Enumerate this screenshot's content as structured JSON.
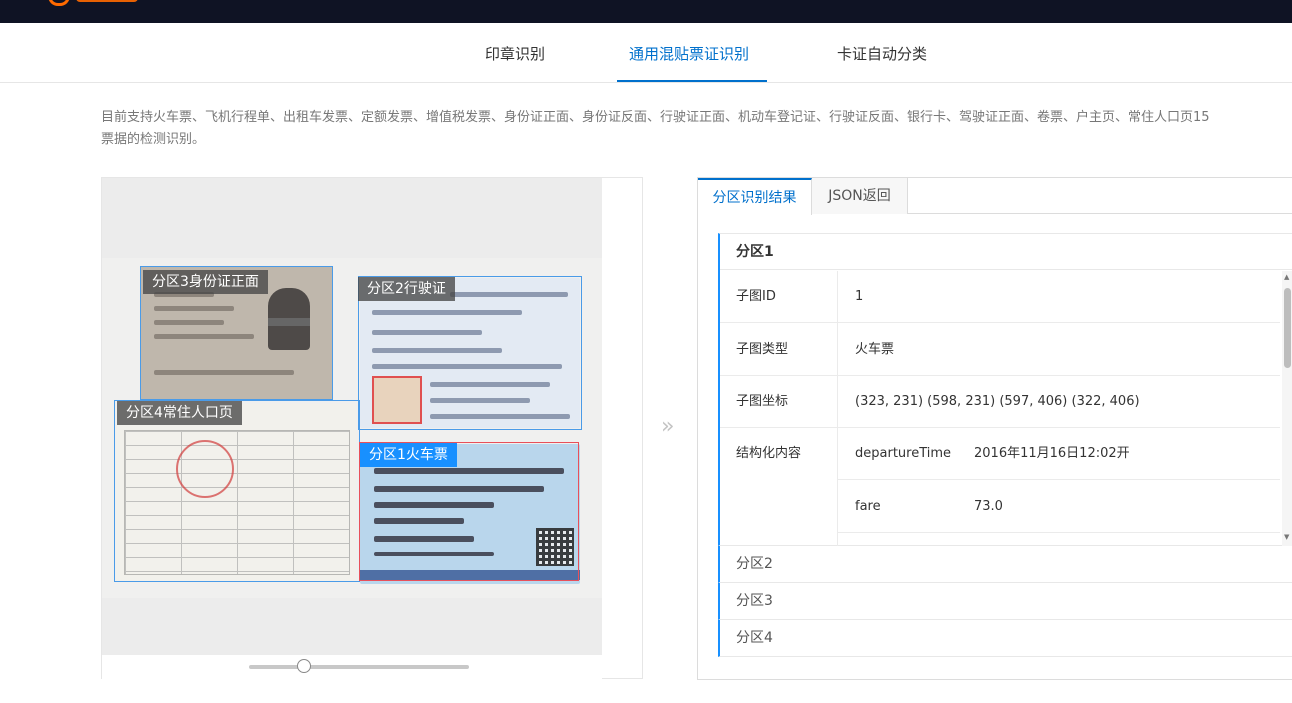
{
  "nav": {
    "tabs": [
      "印章识别",
      "通用混贴票证识别",
      "卡证自动分类"
    ],
    "active_tab": 1
  },
  "description": {
    "line1": "目前支持火车票、飞机行程单、出租车发票、定额发票、增值税发票、身份证正面、身份证反面、行驶证正面、机动车登记证、行驶证反面、银行卡、驾驶证正面、卷票、户主页、常住人口页15",
    "line2": "票据的检测识别。"
  },
  "viewer": {
    "zones": [
      {
        "label": "分区3身份证正面"
      },
      {
        "label": "分区2行驶证"
      },
      {
        "label": "分区4常住人口页"
      },
      {
        "label": "分区1火车票",
        "selected": true
      }
    ],
    "zoom_level": 0.25
  },
  "result": {
    "tabs": [
      "分区识别结果",
      "JSON返回"
    ],
    "sections": [
      {
        "title": "分区1",
        "expanded": true,
        "rows": [
          {
            "key": "子图ID",
            "value": "1"
          },
          {
            "key": "子图类型",
            "value": "火车票"
          },
          {
            "key": "子图坐标",
            "value": "(323, 231) (598, 231) (597, 406) (322, 406)"
          }
        ],
        "structured": {
          "key": "结构化内容",
          "fields": [
            {
              "name": "departureTime",
              "value": "2016年11月16日12:02开"
            },
            {
              "name": "fare",
              "value": "73.0"
            }
          ]
        }
      },
      {
        "title": "分区2"
      },
      {
        "title": "分区3"
      },
      {
        "title": "分区4"
      }
    ]
  },
  "colors": {
    "accent": "#0070cc",
    "selected_zone": "#1890ff",
    "topbar": "#0f1324",
    "brand": "#ff6a00"
  },
  "icons": {
    "forward": "»"
  }
}
